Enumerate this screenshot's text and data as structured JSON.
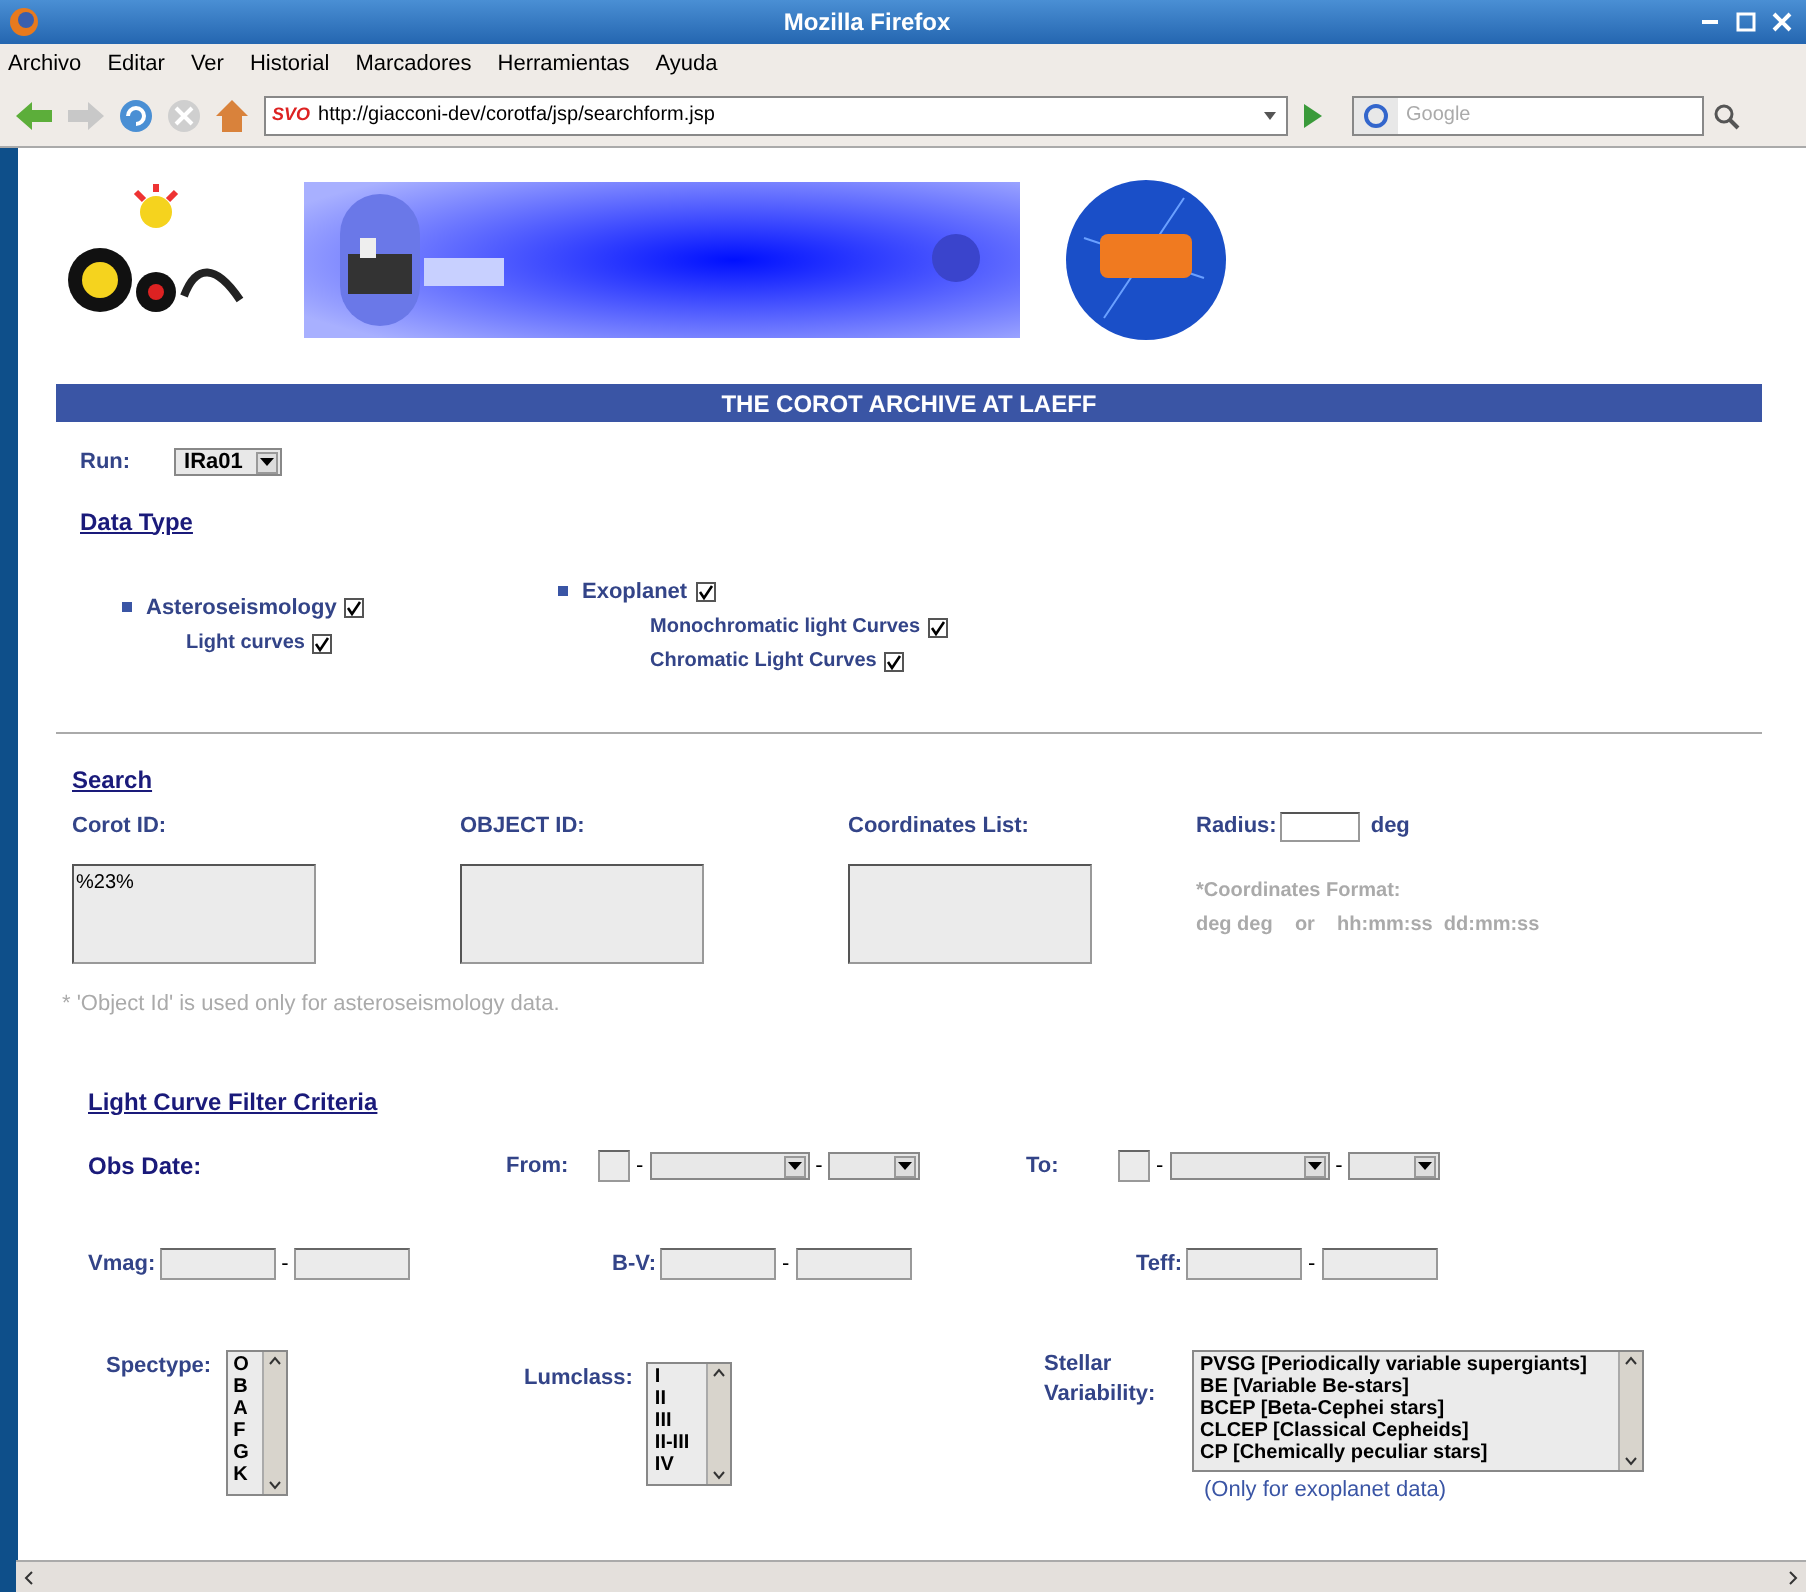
{
  "window": {
    "title": "Mozilla Firefox"
  },
  "menu": [
    "Archivo",
    "Editar",
    "Ver",
    "Historial",
    "Marcadores",
    "Herramientas",
    "Ayuda"
  ],
  "toolbar": {
    "site_badge": "SVO",
    "url": "http://giacconi-dev/corotfa/jsp/searchform.jsp",
    "search_placeholder": "Google"
  },
  "page": {
    "banner_title": "THE COROT ARCHIVE AT LAEFF",
    "run": {
      "label": "Run:",
      "value": "IRa01"
    },
    "data_type": {
      "heading": "Data Type",
      "groups": [
        {
          "label": "Asteroseismology",
          "checked": true,
          "children": [
            {
              "label": "Light curves",
              "checked": true
            }
          ]
        },
        {
          "label": "Exoplanet",
          "checked": true,
          "children": [
            {
              "label": "Monochromatic light Curves",
              "checked": true
            },
            {
              "label": "Chromatic Light Curves",
              "checked": true
            }
          ]
        }
      ]
    },
    "search": {
      "heading": "Search",
      "fields": [
        {
          "label": "Corot ID:",
          "value": "%23%"
        },
        {
          "label": "OBJECT ID:"
        },
        {
          "label": "Coordinates List:"
        }
      ],
      "radius": {
        "label": "Radius:",
        "unit": "deg"
      },
      "coords_note": [
        "*Coordinates Format:",
        "deg deg    or    hh:mm:ss  dd:mm:ss"
      ],
      "footnote": "* 'Object Id' is used only for asteroseismology data."
    },
    "filter": {
      "heading": "Light Curve Filter Criteria",
      "separator": "-",
      "obs_date": {
        "label": "Obs Date:",
        "from": "From:",
        "to": "To:"
      },
      "ranges": [
        {
          "label": "Vmag:"
        },
        {
          "label": "B-V:"
        },
        {
          "label": "Teff:"
        }
      ],
      "spectype": {
        "label": "Spectype:",
        "options": [
          "O",
          "B",
          "A",
          "F",
          "G",
          "K"
        ]
      },
      "lumclass": {
        "label": "Lumclass:",
        "options": [
          "I",
          "II",
          "III",
          "II-III",
          "IV"
        ]
      },
      "variability": {
        "label": "Stellar Variability:",
        "options": [
          "PVSG [Periodically variable supergiants]",
          "BE [Variable Be-stars]",
          "BCEP [Beta-Cephei stars]",
          "CLCEP [Classical Cepheids]",
          "CP [Chemically peculiar stars]"
        ],
        "note": "(Only for exoplanet data)"
      }
    }
  }
}
